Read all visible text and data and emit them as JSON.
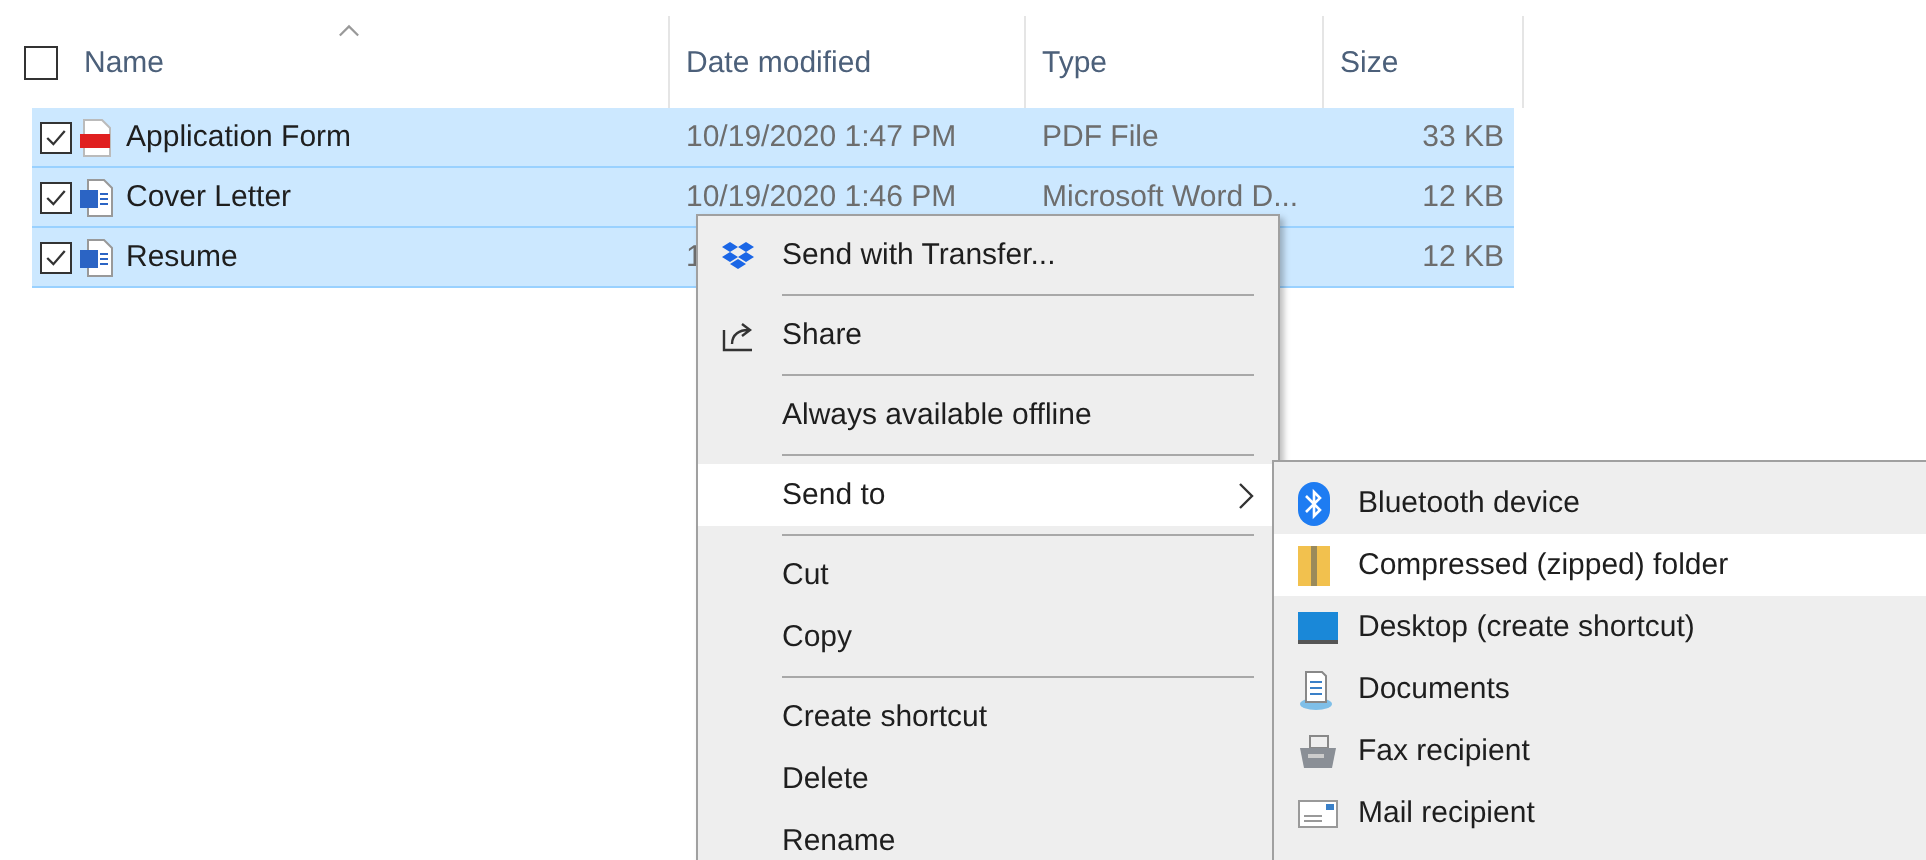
{
  "header": {
    "select_all_checked": false,
    "name_sorted": true,
    "columns": [
      {
        "label": "Name"
      },
      {
        "label": "Date modified"
      },
      {
        "label": "Type"
      },
      {
        "label": "Size"
      }
    ]
  },
  "rows": [
    {
      "name": "Application Form",
      "date": "10/19/2020 1:47 PM",
      "type": "PDF File",
      "size": "33 KB",
      "kind": "pdf",
      "checked": true,
      "selected": true
    },
    {
      "name": "Cover Letter",
      "date": "10/19/2020 1:46 PM",
      "type": "Microsoft Word D...",
      "size": "12 KB",
      "kind": "word",
      "checked": true,
      "selected": true
    },
    {
      "name": "Resume",
      "date": "1",
      "size": "12 KB",
      "kind": "word",
      "checked": true,
      "selected": true
    }
  ],
  "context_menu": {
    "groups": [
      [
        {
          "label": "Send with Transfer...",
          "kind": "dropbox",
          "submenu": false,
          "selected": false
        }
      ],
      [
        {
          "label": "Share",
          "kind": "share",
          "submenu": false,
          "selected": false
        }
      ],
      [
        {
          "label": "Always available offline",
          "kind": "plain",
          "submenu": false,
          "selected": false
        }
      ],
      [
        {
          "label": "Send to",
          "kind": "plain",
          "submenu": true,
          "selected": true
        }
      ],
      [
        {
          "label": "Cut",
          "kind": "plain",
          "submenu": false,
          "selected": false
        },
        {
          "label": "Copy",
          "kind": "plain",
          "submenu": false,
          "selected": false
        }
      ],
      [
        {
          "label": "Create shortcut",
          "kind": "plain",
          "submenu": false,
          "selected": false
        },
        {
          "label": "Delete",
          "kind": "plain",
          "submenu": false,
          "selected": false
        },
        {
          "label": "Rename",
          "kind": "plain",
          "submenu": false,
          "selected": false
        }
      ]
    ]
  },
  "submenu": {
    "items": [
      {
        "label": "Bluetooth device",
        "kind": "bluetooth",
        "selected": false
      },
      {
        "label": "Compressed (zipped) folder",
        "kind": "zip",
        "selected": true
      },
      {
        "label": "Desktop (create shortcut)",
        "kind": "desktop",
        "selected": false
      },
      {
        "label": "Documents",
        "kind": "documents",
        "selected": false
      },
      {
        "label": "Fax recipient",
        "kind": "fax",
        "selected": false
      },
      {
        "label": "Mail recipient",
        "kind": "mail",
        "selected": false
      }
    ]
  }
}
